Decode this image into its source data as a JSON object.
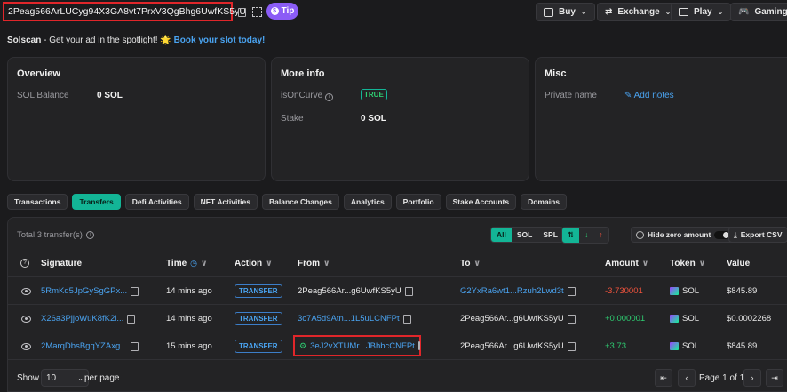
{
  "header": {
    "address": "2Peag566ArLUCyg94X3GA8vt7PrxV3QgBhg6UwfKS5yU",
    "tip_label": "Tip",
    "menu": [
      {
        "label": "Buy"
      },
      {
        "label": "Exchange"
      },
      {
        "label": "Play"
      },
      {
        "label": "Gaming"
      }
    ]
  },
  "ad": {
    "brand": "Solscan",
    "text": " - Get your ad in the spotlight! ",
    "emoji": "🌟",
    "link": "Book your slot today!"
  },
  "overview": {
    "title": "Overview",
    "sol_balance_label": "SOL Balance",
    "sol_balance_value": "0 SOL"
  },
  "more_info": {
    "title": "More info",
    "is_on_curve_label": "isOnCurve",
    "is_on_curve_value": "TRUE",
    "stake_label": "Stake",
    "stake_value": "0 SOL"
  },
  "misc": {
    "title": "Misc",
    "private_name_label": "Private name",
    "add_notes": "Add notes"
  },
  "tabs": [
    "Transactions",
    "Transfers",
    "Defi Activities",
    "NFT Activities",
    "Balance Changes",
    "Analytics",
    "Portfolio",
    "Stake Accounts",
    "Domains"
  ],
  "transfers": {
    "total_label": "Total 3 transfer(s)",
    "filters": [
      "All",
      "SOL",
      "SPL"
    ],
    "hide_zero": "Hide zero amount",
    "export": "Export CSV",
    "columns": {
      "signature": "Signature",
      "time": "Time",
      "action": "Action",
      "from": "From",
      "to": "To",
      "amount": "Amount",
      "token": "Token",
      "value": "Value"
    },
    "rows": [
      {
        "signature": "5RmKd5JpGySgGPx...",
        "time": "14 mins ago",
        "action": "TRANSFER",
        "from": "2Peag566Ar...g6UwfKS5yU",
        "to": "G2YxRa6wt1...Rzuh2Lwd3t",
        "amount": "-3.730001",
        "token": "SOL",
        "value": "$845.89"
      },
      {
        "signature": "X26a3PjjoWuK8fK2i...",
        "time": "14 mins ago",
        "action": "TRANSFER",
        "from": "3c7A5d9Atn...1L5uLCNFPt",
        "to": "2Peag566Ar...g6UwfKS5yU",
        "amount": "+0.000001",
        "token": "SOL",
        "value": "$0.0002268"
      },
      {
        "signature": "2MarqDbsBgqYZAxg...",
        "time": "15 mins ago",
        "action": "TRANSFER",
        "from": "3eJ2vXTUMr...JBhbcCNFPt",
        "to": "2Peag566Ar...g6UwfKS5yU",
        "amount": "+3.73",
        "token": "SOL",
        "value": "$845.89"
      }
    ]
  },
  "pagination": {
    "show_label": "Show",
    "page_size": "10",
    "per_page": "per page",
    "page_text": "Page 1 of 1"
  },
  "colors": {
    "accent": "#13b596",
    "link": "#4aa3f0",
    "negative": "#f0533d",
    "positive": "#2ecc71",
    "highlight": "#e0262a"
  }
}
